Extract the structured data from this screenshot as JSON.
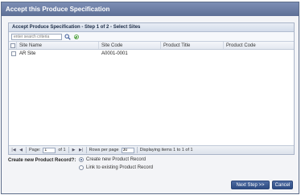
{
  "dialog": {
    "title": "Accept this Produce Specification"
  },
  "panel": {
    "heading": "Accept Produce Specification - Step 1 of 2 - Select Sites",
    "search_placeholder": "enter search criteria"
  },
  "grid": {
    "columns": [
      "Site Name",
      "Site Code",
      "Product Title",
      "Product Code"
    ],
    "rows": [
      {
        "site_name": "AR Site",
        "site_code": "A0001-0001",
        "product_title": "",
        "product_code": ""
      }
    ]
  },
  "pager": {
    "page_label": "Page:",
    "page_value": "1",
    "of_label": "of 1",
    "rows_label": "Rows per page",
    "rows_value": "30",
    "displaying": "Displaying items 1 to 1 of 1"
  },
  "record": {
    "label": "Create new Product Record?:",
    "options": [
      {
        "label": "Create new Product Record",
        "selected": true
      },
      {
        "label": "Link to existing Product Record",
        "selected": false
      }
    ]
  },
  "buttons": {
    "next": "Next Step >>",
    "cancel": "Cancel"
  }
}
